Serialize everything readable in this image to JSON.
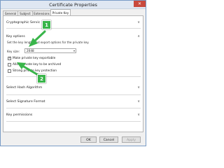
{
  "window": {
    "title": "Certificate Properties",
    "close_glyph": "✕"
  },
  "tabs": [
    {
      "label": "General"
    },
    {
      "label": "Subject"
    },
    {
      "label": "Extensions"
    },
    {
      "label": "Private Key",
      "active": true
    }
  ],
  "sections": {
    "csp": {
      "label": "Cryptographic Servic"
    },
    "key_options": {
      "label": "Key options",
      "description": "Set the key length and export options for the private key.",
      "key_size_label": "Key size:",
      "key_size_value": "2048",
      "options": [
        {
          "label": "Make private key exportable",
          "checked": true
        },
        {
          "label": "Allow private key to be archived",
          "checked": false
        },
        {
          "label": "Strong private key protection",
          "checked": false
        }
      ]
    },
    "hash": {
      "label": "Select Hash Algorithm"
    },
    "signature": {
      "label": "Select Signature Format"
    },
    "permissions": {
      "label": "Key permissions"
    }
  },
  "icons": {
    "chevron_down": "∨",
    "chevron_up": "∧",
    "dropdown_arrow": "▾"
  },
  "buttons": {
    "ok": "OK",
    "cancel": "Cancel",
    "apply": "Apply"
  },
  "callouts": [
    "1",
    "2"
  ],
  "colors": {
    "callout_green": "#39b54a",
    "close_red": "#c94a3d"
  }
}
